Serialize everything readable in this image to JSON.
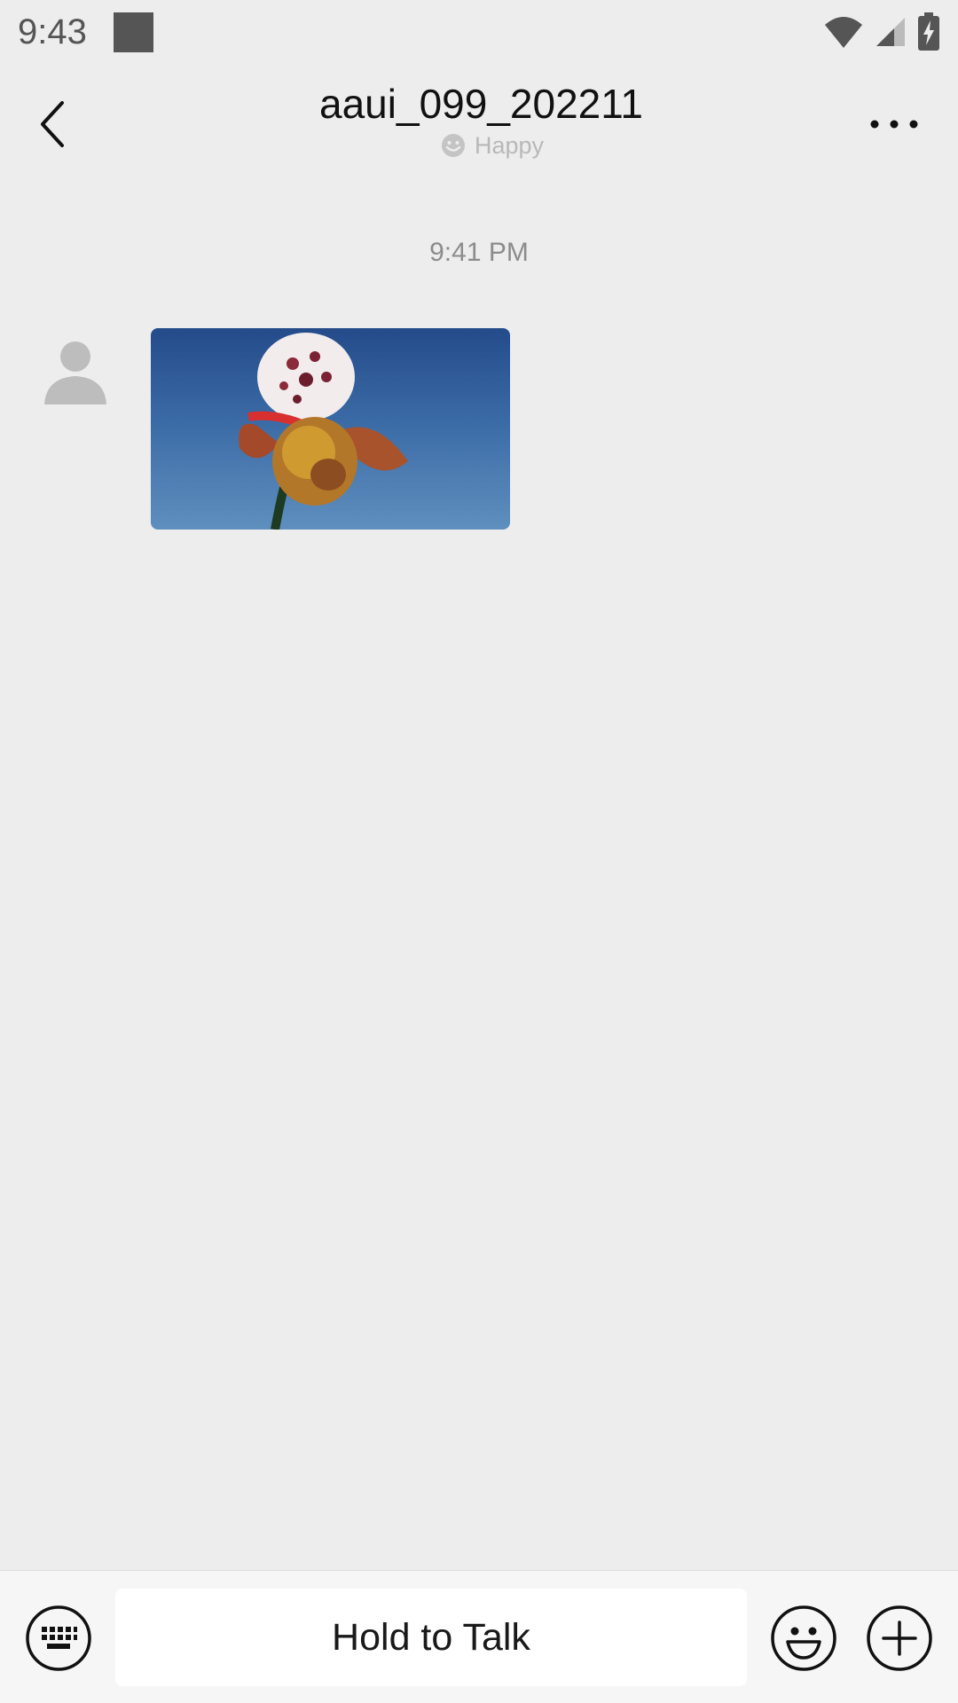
{
  "status_bar": {
    "time": "9:43",
    "icons": [
      "notification-square-icon",
      "wifi-icon",
      "cell-signal-icon",
      "battery-charging-icon"
    ]
  },
  "header": {
    "back_icon": "chevron-left-icon",
    "title": "aaui_099_202211",
    "status_icon": "smiley-icon",
    "status_text": "Happy",
    "more_icon": "more-dots-icon"
  },
  "chat": {
    "timestamp": "9:41 PM",
    "messages": [
      {
        "type": "image",
        "sender_avatar": "default-person-avatar-icon",
        "image_description_icon": "flower-photo"
      }
    ]
  },
  "bottom_bar": {
    "keyboard_icon": "keyboard-icon",
    "talk_label": "Hold to Talk",
    "emoji_icon": "emoji-icon",
    "plus_icon": "plus-circle-icon"
  },
  "colors": {
    "background": "#ededed",
    "bottom_bar": "#f6f6f6",
    "title_text": "#111111",
    "muted_text": "#8c8c8c"
  }
}
